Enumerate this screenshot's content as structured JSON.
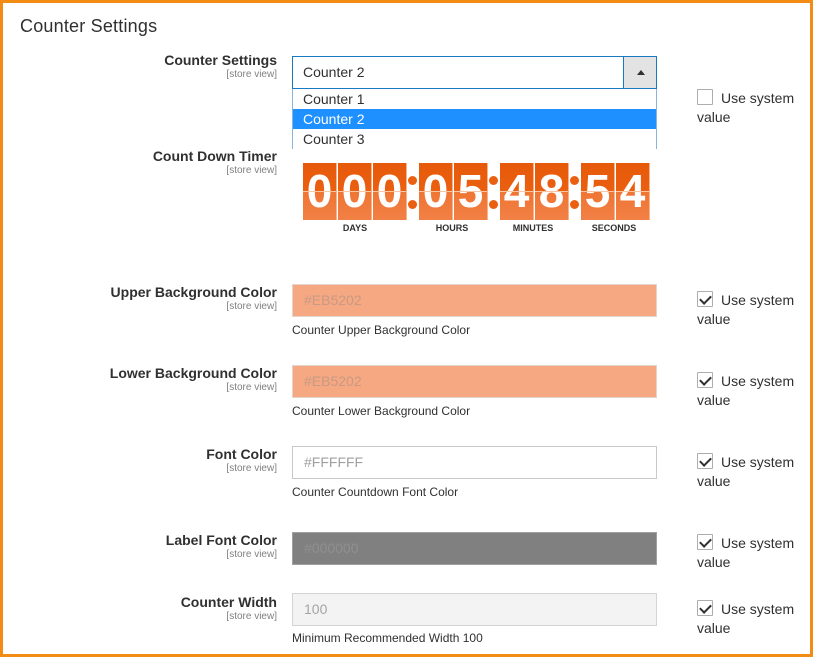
{
  "section_title": "Counter Settings",
  "scope_label": "[store view]",
  "use_system_value_label": "Use system value",
  "counter_settings": {
    "label": "Counter Settings",
    "selected": "Counter 2",
    "options": [
      "Counter 1",
      "Counter 2",
      "Counter 3"
    ],
    "use_system_value": false
  },
  "countdown": {
    "label": "Count Down Timer",
    "days": [
      "0",
      "0",
      "0"
    ],
    "hours": [
      "0",
      "5"
    ],
    "minutes": [
      "4",
      "8"
    ],
    "seconds": [
      "5",
      "4"
    ],
    "units": {
      "days": "DAYS",
      "hours": "HOURS",
      "minutes": "MINUTES",
      "seconds": "SECONDS"
    },
    "digit_bg_color": "#EB5202"
  },
  "fields": [
    {
      "label": "Upper Background Color",
      "value": "#EB5202",
      "note": "Counter Upper Background Color",
      "use_system_value": true
    },
    {
      "label": "Lower Background Color",
      "value": "#EB5202",
      "note": "Counter Lower Background Color",
      "use_system_value": true
    },
    {
      "label": "Font Color",
      "value": "#FFFFFF",
      "note": "Counter Countdown Font Color",
      "use_system_value": true
    },
    {
      "label": "Label Font Color",
      "value": "#000000",
      "note": "",
      "use_system_value": true
    },
    {
      "label": "Counter Width",
      "value": "100",
      "note": "Minimum Recommended Width 100",
      "use_system_value": true
    }
  ]
}
